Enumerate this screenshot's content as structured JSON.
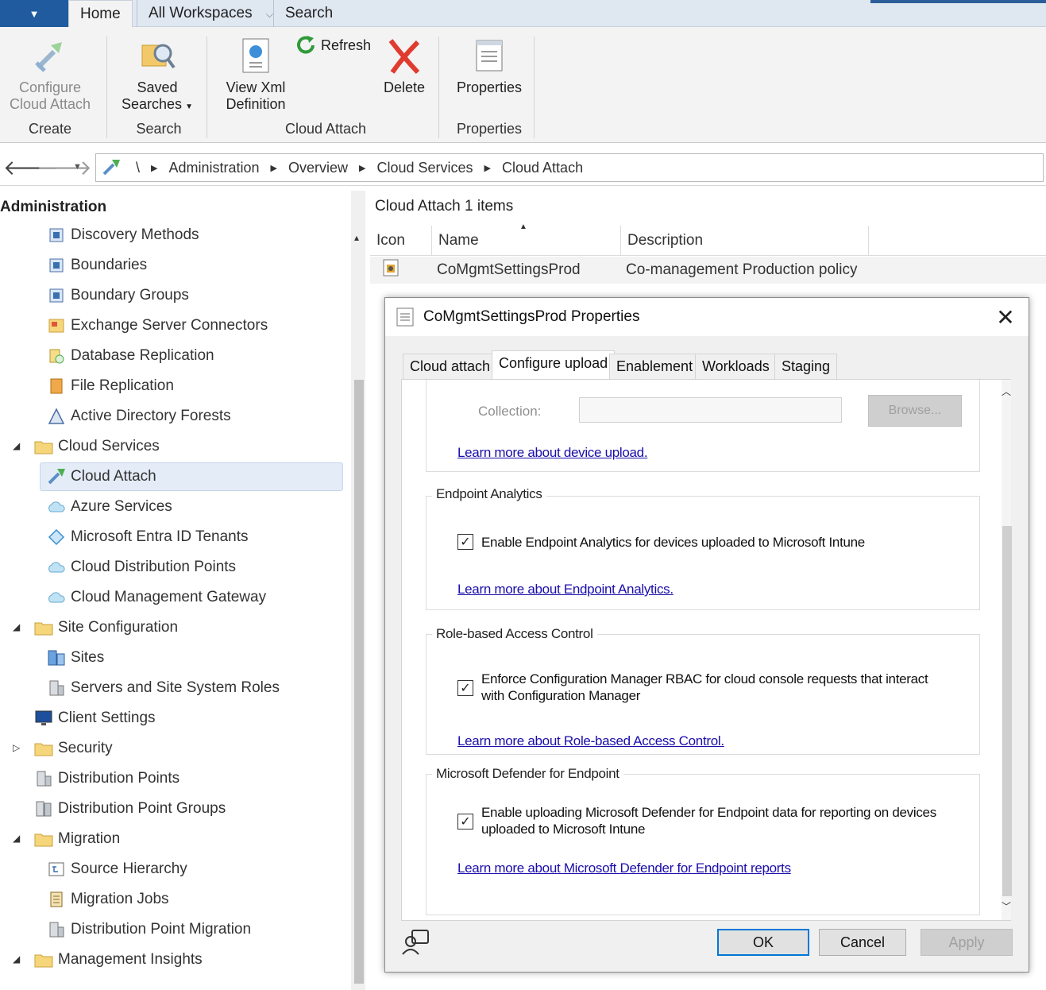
{
  "top_tabs": {
    "home": "Home",
    "workspaces": "All Workspaces",
    "search": "Search"
  },
  "ribbon": {
    "configure": "Configure\nCloud Attach",
    "create_group": "Create",
    "saved_searches": "Saved\nSearches",
    "search_group": "Search",
    "view_xml": "View Xml\nDefinition",
    "refresh": "Refresh",
    "delete": "Delete",
    "cloud_attach_group": "Cloud Attach",
    "properties": "Properties",
    "properties_group": "Properties"
  },
  "breadcrumb": {
    "root": "\\",
    "items": [
      "Administration",
      "Overview",
      "Cloud Services",
      "Cloud Attach"
    ]
  },
  "tree": {
    "header": "Administration",
    "items": [
      {
        "label": "Discovery Methods",
        "icon": "discovery-icon"
      },
      {
        "label": "Boundaries",
        "icon": "boundary-icon"
      },
      {
        "label": "Boundary Groups",
        "icon": "boundary-group-icon"
      },
      {
        "label": "Exchange Server Connectors",
        "icon": "exchange-icon"
      },
      {
        "label": "Database Replication",
        "icon": "database-icon"
      },
      {
        "label": "File Replication",
        "icon": "file-replication-icon"
      },
      {
        "label": "Active Directory Forests",
        "icon": "forest-icon"
      },
      {
        "label": "Cloud Services",
        "icon": "folder-icon"
      },
      {
        "label": "Cloud Attach",
        "icon": "cloud-attach-icon"
      },
      {
        "label": "Azure Services",
        "icon": "cloud-icon"
      },
      {
        "label": "Microsoft Entra ID Tenants",
        "icon": "entra-icon"
      },
      {
        "label": "Cloud Distribution Points",
        "icon": "cloud-icon"
      },
      {
        "label": "Cloud Management Gateway",
        "icon": "cloud-icon"
      },
      {
        "label": "Site Configuration",
        "icon": "folder-icon"
      },
      {
        "label": "Sites",
        "icon": "sites-icon"
      },
      {
        "label": "Servers and Site System Roles",
        "icon": "server-icon"
      },
      {
        "label": "Client Settings",
        "icon": "monitor-icon"
      },
      {
        "label": "Security",
        "icon": "folder-icon"
      },
      {
        "label": "Distribution Points",
        "icon": "server-icon"
      },
      {
        "label": "Distribution Point Groups",
        "icon": "server-group-icon"
      },
      {
        "label": "Migration",
        "icon": "folder-icon"
      },
      {
        "label": "Source Hierarchy",
        "icon": "hierarchy-icon"
      },
      {
        "label": "Migration Jobs",
        "icon": "jobs-icon"
      },
      {
        "label": "Distribution Point Migration",
        "icon": "server-icon"
      },
      {
        "label": "Management Insights",
        "icon": "folder-icon"
      }
    ]
  },
  "list": {
    "title": "Cloud Attach 1 items",
    "columns": [
      "Icon",
      "Name",
      "Description"
    ],
    "rows": [
      {
        "name": "CoMgmtSettingsProd",
        "description": "Co-management Production policy"
      }
    ]
  },
  "dialog": {
    "title": "CoMgmtSettingsProd Properties",
    "tabs": [
      "Cloud attach",
      "Configure upload",
      "Enablement",
      "Workloads",
      "Staging"
    ],
    "collection_label": "Collection:",
    "collection_value": "",
    "browse": "Browse...",
    "device_upload_link": "Learn more about device upload.",
    "endpoint_analytics": {
      "title": "Endpoint Analytics",
      "checkbox": "Enable Endpoint Analytics for devices uploaded to Microsoft Intune",
      "checked": true,
      "link": "Learn more about Endpoint Analytics."
    },
    "rbac": {
      "title": "Role-based Access Control",
      "checkbox_line1": "Enforce Configuration Manager RBAC for cloud console requests that interact",
      "checkbox_line2": "with Configuration Manager",
      "checked": true,
      "link": "Learn more about Role-based Access Control."
    },
    "defender": {
      "title": "Microsoft Defender for Endpoint",
      "checkbox_line1": "Enable uploading Microsoft Defender for Endpoint data for reporting on devices",
      "checkbox_line2": "uploaded to Microsoft Intune",
      "checked": true,
      "link": "Learn more about Microsoft Defender for Endpoint reports"
    },
    "ok": "OK",
    "cancel": "Cancel",
    "apply": "Apply"
  }
}
